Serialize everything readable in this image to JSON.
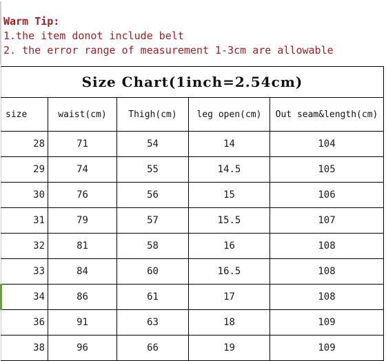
{
  "tips": {
    "heading": "Warm Tip:",
    "lines": [
      "1.the item donot include belt",
      "2. the error range of measurement 1-3cm are allowable"
    ],
    "color": "#9e1f25"
  },
  "table": {
    "title": "Size Chart(1inch=2.54cm)",
    "headers": [
      "size",
      "waist(cm)",
      "Thigh(cm)",
      "leg open(cm)",
      "Out seam&length(cm)"
    ],
    "highlight_color": "#6f9a4b",
    "highlighted_size": "34",
    "rows": [
      {
        "size": "28",
        "waist": "71",
        "thigh": "54",
        "leg_open": "14",
        "out_seam": "104"
      },
      {
        "size": "29",
        "waist": "74",
        "thigh": "55",
        "leg_open": "14.5",
        "out_seam": "105"
      },
      {
        "size": "30",
        "waist": "76",
        "thigh": "56",
        "leg_open": "15",
        "out_seam": "106"
      },
      {
        "size": "31",
        "waist": "79",
        "thigh": "57",
        "leg_open": "15.5",
        "out_seam": "107"
      },
      {
        "size": "32",
        "waist": "81",
        "thigh": "58",
        "leg_open": "16",
        "out_seam": "108"
      },
      {
        "size": "33",
        "waist": "84",
        "thigh": "60",
        "leg_open": "16.5",
        "out_seam": "108"
      },
      {
        "size": "34",
        "waist": "86",
        "thigh": "61",
        "leg_open": "17",
        "out_seam": "108"
      },
      {
        "size": "36",
        "waist": "91",
        "thigh": "63",
        "leg_open": "18",
        "out_seam": "109"
      },
      {
        "size": "38",
        "waist": "96",
        "thigh": "66",
        "leg_open": "19",
        "out_seam": "109"
      }
    ]
  }
}
